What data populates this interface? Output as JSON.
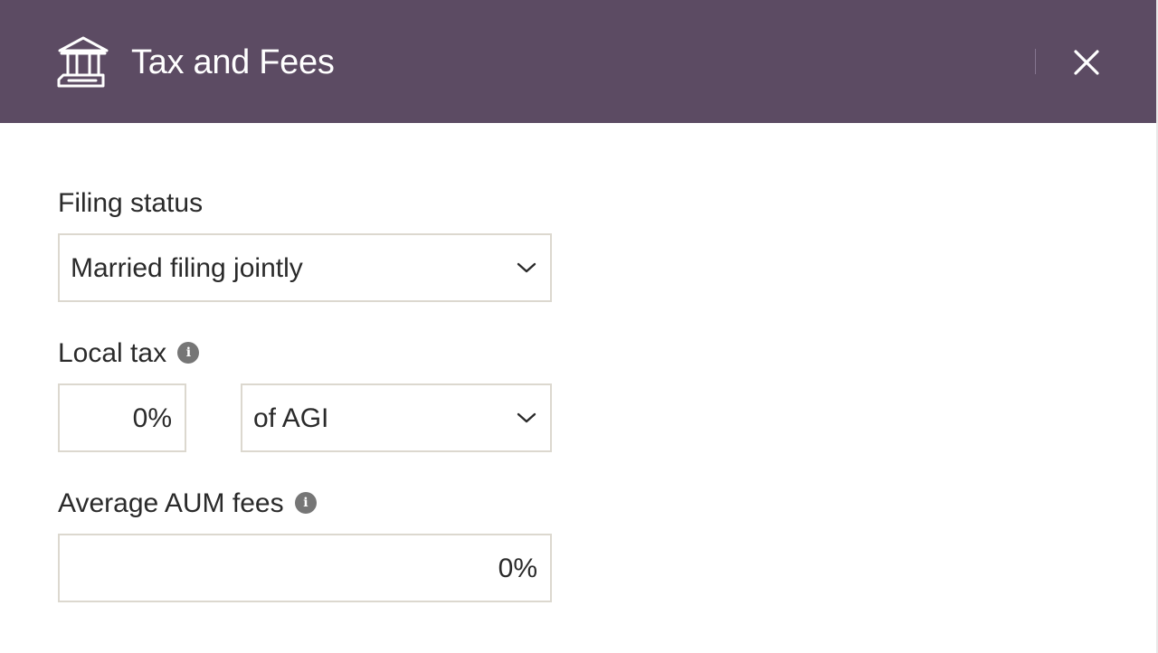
{
  "header": {
    "title": "Tax and Fees",
    "icon": "bank-icon",
    "close_icon": "close-icon",
    "background_color": "#5c4b63"
  },
  "filing_status": {
    "label": "Filing status",
    "selected": "Married filing jointly"
  },
  "local_tax": {
    "label": "Local tax",
    "info_icon": "info-icon",
    "value": "0%",
    "basis_selected": "of AGI"
  },
  "aum_fees": {
    "label": "Average AUM fees",
    "info_icon": "info-icon",
    "value": "0%"
  },
  "info_glyph": "i"
}
